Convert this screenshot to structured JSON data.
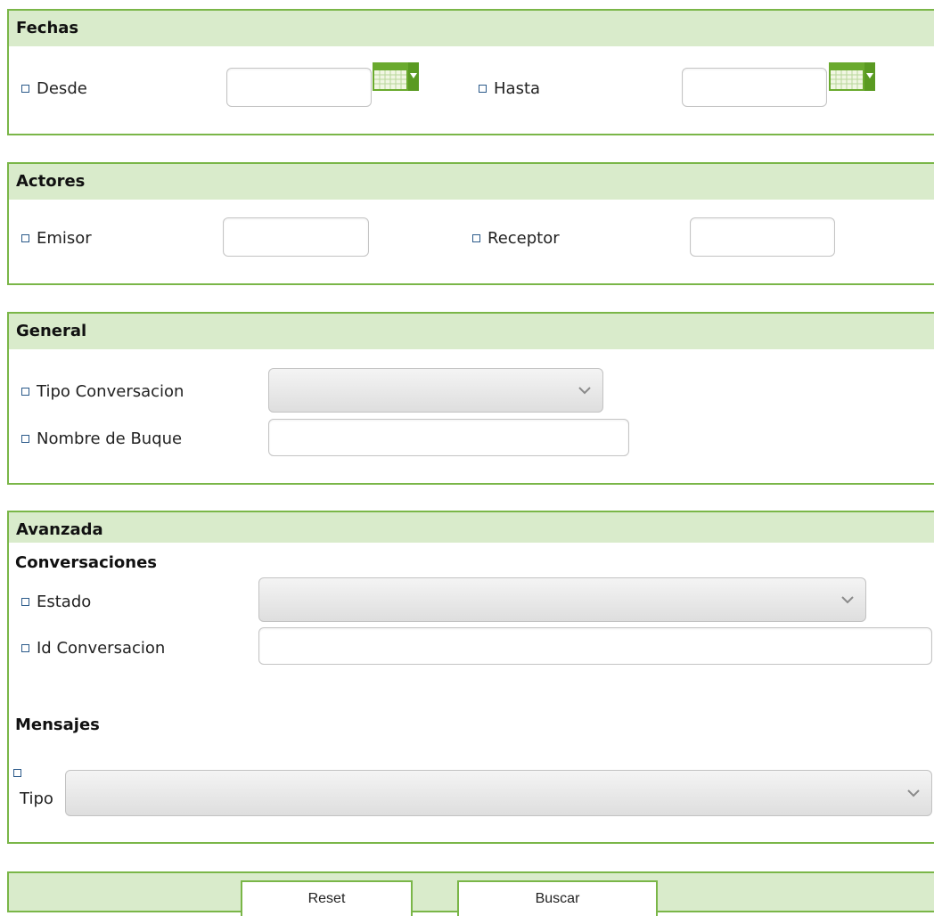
{
  "fechas": {
    "title": "Fechas",
    "desde_label": "Desde",
    "desde_value": "",
    "hasta_label": "Hasta",
    "hasta_value": ""
  },
  "actores": {
    "title": "Actores",
    "emisor_label": "Emisor",
    "emisor_value": "",
    "receptor_label": "Receptor",
    "receptor_value": ""
  },
  "general": {
    "title": "General",
    "tipo_conversacion_label": "Tipo Conversacion",
    "tipo_conversacion_value": "",
    "nombre_buque_label": "Nombre de Buque",
    "nombre_buque_value": ""
  },
  "avanzada": {
    "title": "Avanzada",
    "conversaciones_heading": "Conversaciones",
    "estado_label": "Estado",
    "estado_value": "",
    "id_conversacion_label": "Id Conversacion",
    "id_conversacion_value": "",
    "mensajes_heading": "Mensajes",
    "tipo_label": "Tipo",
    "tipo_value": ""
  },
  "actions": {
    "reset_label": "Reset",
    "buscar_label": "Buscar"
  },
  "colors": {
    "panel_border": "#7ab648",
    "panel_header_bg": "#d9ebcb",
    "calendar_icon_green": "#6aaa2e"
  },
  "icons": {
    "calendar": "calendar-dropdown-icon",
    "select_arrow": "chevron-down-icon",
    "bullet": "square-bullet-icon"
  }
}
